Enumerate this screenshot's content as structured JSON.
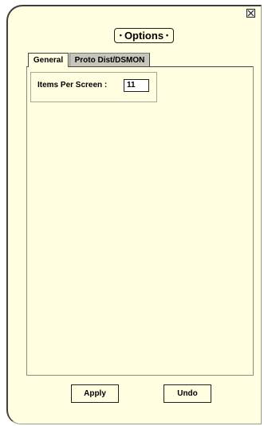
{
  "dialog": {
    "title": "Options",
    "close_icon": "close-icon"
  },
  "tabs": [
    {
      "label": "General",
      "active": true
    },
    {
      "label": "Proto Dist/DSMON",
      "active": false
    }
  ],
  "general": {
    "items_per_screen_label": "Items Per Screen :",
    "items_per_screen_value": "11"
  },
  "buttons": {
    "apply_label": "Apply",
    "undo_label": "Undo"
  },
  "colors": {
    "background": "#fffee0",
    "inactive_tab": "#c6c6bc",
    "border": "#222222"
  }
}
